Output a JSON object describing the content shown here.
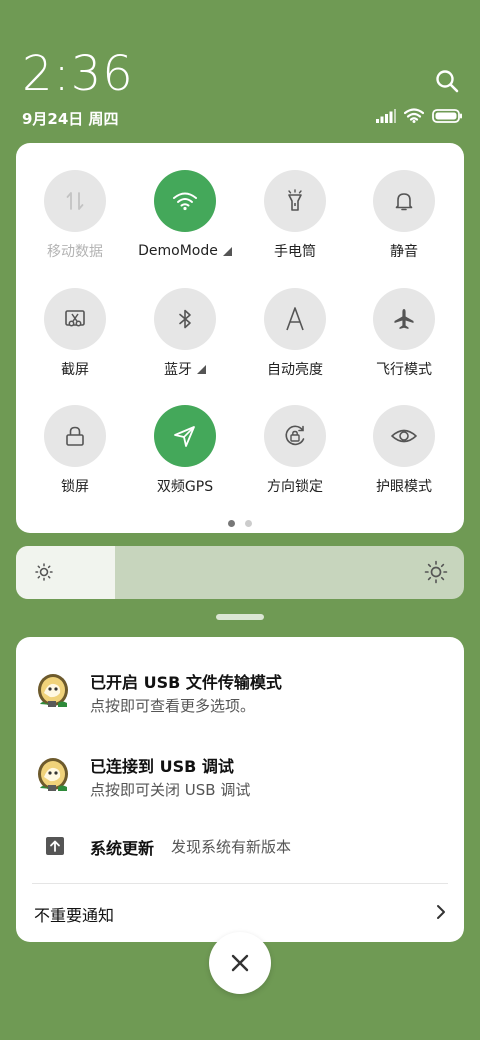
{
  "status_bar": {
    "time": "2:36",
    "date": "9月24日 周四"
  },
  "icons": {
    "search": "search-icon",
    "signal": "cellular-signal-icon",
    "wifi": "wifi-icon",
    "battery": "battery-icon"
  },
  "colors": {
    "background": "#6f9a54",
    "accent_on": "#44a85a",
    "tile_off": "#e6e6e6"
  },
  "quick_settings": {
    "tiles": [
      {
        "label": "移动数据",
        "icon": "mobile-data-icon",
        "state": "disabled"
      },
      {
        "label": "DemoMode",
        "icon": "wifi-icon",
        "state": "on",
        "expandable": true
      },
      {
        "label": "手电筒",
        "icon": "flashlight-icon",
        "state": "off"
      },
      {
        "label": "静音",
        "icon": "bell-icon",
        "state": "off"
      },
      {
        "label": "截屏",
        "icon": "screenshot-icon",
        "state": "off"
      },
      {
        "label": "蓝牙",
        "icon": "bluetooth-icon",
        "state": "off",
        "expandable": true
      },
      {
        "label": "自动亮度",
        "icon": "auto-brightness-icon",
        "state": "off"
      },
      {
        "label": "飞行模式",
        "icon": "airplane-icon",
        "state": "off"
      },
      {
        "label": "锁屏",
        "icon": "lock-icon",
        "state": "off"
      },
      {
        "label": "双频GPS",
        "icon": "gps-icon",
        "state": "on"
      },
      {
        "label": "方向锁定",
        "icon": "rotation-lock-icon",
        "state": "off"
      },
      {
        "label": "护眼模式",
        "icon": "eye-icon",
        "state": "off"
      }
    ],
    "page_count": 2,
    "current_page": 1
  },
  "brightness": {
    "level_fraction": 0.22
  },
  "notifications": [
    {
      "title": "已开启 USB 文件传输模式",
      "body": "点按即可查看更多选项。",
      "icon": "android-system-icon"
    },
    {
      "title": "已连接到 USB 调试",
      "body": "点按即可关闭 USB 调试",
      "icon": "android-system-icon"
    }
  ],
  "system_update": {
    "title": "系统更新",
    "body": "发现系统有新版本",
    "icon": "upload-arrow-icon"
  },
  "unimportant": {
    "label": "不重要通知"
  },
  "close": {
    "icon": "close-icon"
  }
}
